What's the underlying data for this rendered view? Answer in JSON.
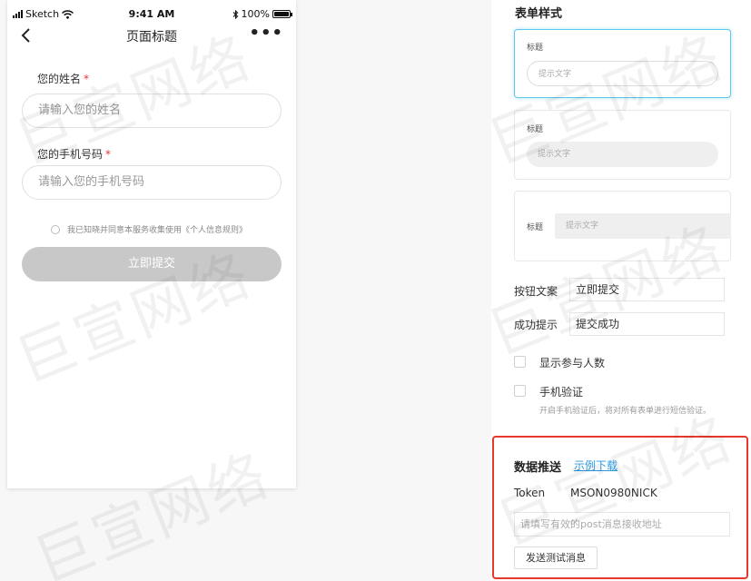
{
  "status_bar": {
    "carrier": "Sketch",
    "time": "9:41 AM",
    "battery": "100%"
  },
  "nav": {
    "back_icon": "chevron-left-icon",
    "title": "页面标题",
    "more_icon": "more-icon",
    "more_glyph": "•••"
  },
  "form": {
    "name_label": "您的姓名",
    "name_placeholder": "请输入您的姓名",
    "phone_label": "您的手机号码",
    "phone_placeholder": "请输入您的手机号码",
    "required_mark": "*",
    "consent_text": "我已知晓并同意本服务收集使用《个人信息规则》",
    "submit_label": "立即提交"
  },
  "settings": {
    "section_title": "表单样式",
    "styles": [
      {
        "label": "标题",
        "placeholder": "提示文字"
      },
      {
        "label": "标题",
        "placeholder": "提示文字"
      },
      {
        "label": "标题",
        "placeholder": "提示文字"
      }
    ],
    "button_text_label": "按钮文案",
    "button_text_value": "立即提交",
    "success_label": "成功提示",
    "success_value": "提交成功",
    "show_count_label": "显示参与人数",
    "phone_verify_label": "手机验证",
    "phone_verify_hint": "开启手机验证后，将对所有表单进行短信验证。"
  },
  "data_push": {
    "title": "数据推送",
    "example_link": "示例下载",
    "token_label": "Token",
    "token_value": "MSON0980NICK",
    "url_placeholder": "请填写有效的post消息接收地址",
    "send_button": "发送测试消息"
  },
  "watermark": "巨宣网络",
  "colors": {
    "accent_border": "#5cc7e8",
    "highlight_box": "#e8372b",
    "link": "#2b98e0",
    "required": "#e0363a",
    "disabled_button": "#c8c8c8"
  }
}
